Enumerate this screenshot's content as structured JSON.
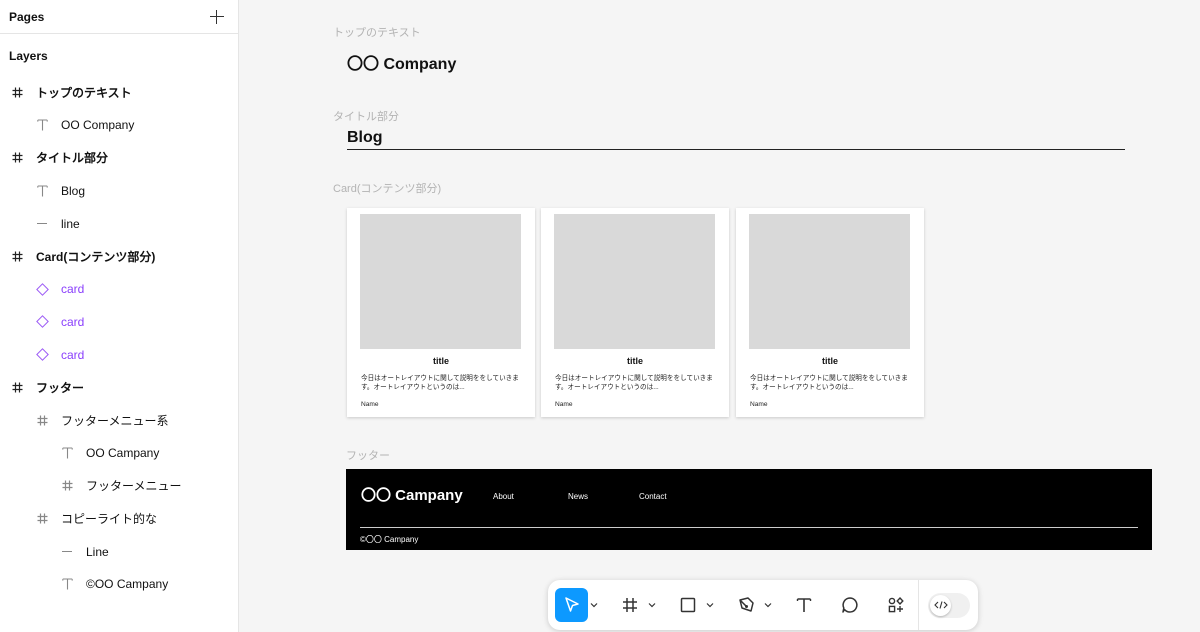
{
  "sidebar": {
    "pages_title": "Pages",
    "layers_title": "Layers",
    "layers": [
      {
        "label": "トップのテキスト",
        "icon": "frame-icon",
        "level": 0
      },
      {
        "label": "OO Company",
        "icon": "text-icon",
        "level": 1
      },
      {
        "label": "タイトル部分",
        "icon": "frame-icon",
        "level": 0
      },
      {
        "label": "Blog",
        "icon": "text-icon",
        "level": 1
      },
      {
        "label": "line",
        "icon": "line-icon",
        "level": 1
      },
      {
        "label": "Card(コンテンツ部分)",
        "icon": "frame-icon",
        "level": 0
      },
      {
        "label": "card",
        "icon": "component-instance-icon",
        "level": 1
      },
      {
        "label": "card",
        "icon": "component-instance-icon",
        "level": 1
      },
      {
        "label": "card",
        "icon": "component-instance-icon",
        "level": 1
      },
      {
        "label": "フッター",
        "icon": "frame-icon",
        "level": 0
      },
      {
        "label": "フッターメニュー系",
        "icon": "frame-icon",
        "level": 1
      },
      {
        "label": "OO Campany",
        "icon": "text-icon",
        "level": 2
      },
      {
        "label": "フッターメニュー",
        "icon": "frame-icon",
        "level": 2
      },
      {
        "label": "コピーライト的な",
        "icon": "frame-icon",
        "level": 1
      },
      {
        "label": "Line",
        "icon": "line-icon",
        "level": 2
      },
      {
        "label": "©OO Campany",
        "icon": "text-icon",
        "level": 2
      }
    ]
  },
  "canvas": {
    "top_label": "トップのテキスト",
    "company": "〇〇 Company",
    "title_label": "タイトル部分",
    "blog": "Blog",
    "card_label": "Card(コンテンツ部分)",
    "cards": [
      {
        "title": "title",
        "desc": "今日はオートレイアウトに関して説明ををしていきます。オートレイアウトというのは...",
        "name": "Name"
      },
      {
        "title": "title",
        "desc": "今日はオートレイアウトに関して説明ををしていきます。オートレイアウトというのは...",
        "name": "Name"
      },
      {
        "title": "title",
        "desc": "今日はオートレイアウトに関して説明ををしていきます。オートレイアウトというのは...",
        "name": "Name"
      }
    ],
    "footer_label": "フッター",
    "footer": {
      "logo": "〇〇 Campany",
      "nav": [
        "About",
        "News",
        "Contact"
      ],
      "copyright": "©〇〇 Campany"
    }
  },
  "toolbar": {
    "tools": [
      "move-tool",
      "frame-tool",
      "rectangle-tool",
      "pen-tool",
      "text-tool",
      "comment-tool",
      "actions-tool"
    ],
    "dev_mode": "dev-mode-toggle"
  },
  "colors": {
    "accent": "#0d99ff",
    "component": "#8a3ffc",
    "placeholder": "#d9d9d9",
    "canvas_bg": "#f5f5f5",
    "footer_bg": "#000000"
  }
}
